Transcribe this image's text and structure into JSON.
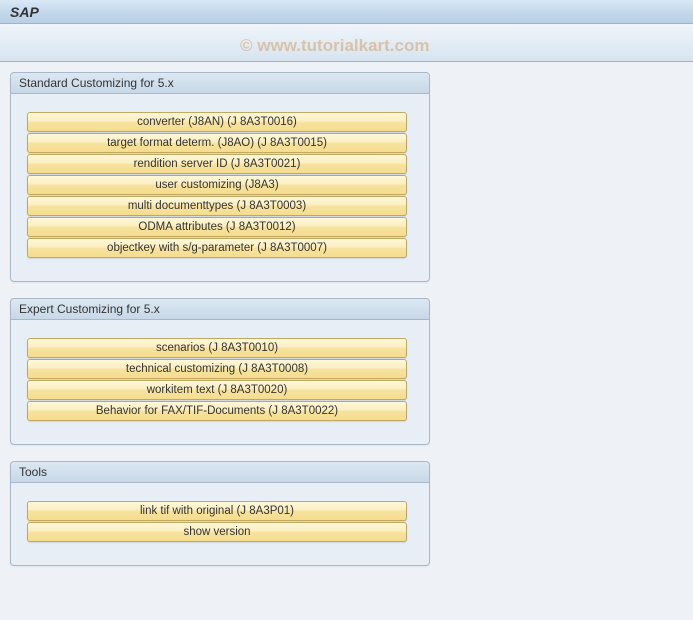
{
  "title": "SAP",
  "watermark": "© www.tutorialkart.com",
  "groups": [
    {
      "header": "Standard Customizing for 5.x",
      "buttons": [
        "converter (J8AN) (J 8A3T0016)",
        "target format determ. (J8AO) (J 8A3T0015)",
        "rendition server ID (J 8A3T0021)",
        "user customizing (J8A3)",
        "multi documenttypes (J 8A3T0003)",
        "ODMA attributes (J 8A3T0012)",
        "objectkey with s/g-parameter (J 8A3T0007)"
      ]
    },
    {
      "header": "Expert Customizing for 5.x",
      "buttons": [
        "scenarios (J 8A3T0010)",
        "technical customizing (J 8A3T0008)",
        "workitem text (J 8A3T0020)",
        "Behavior for FAX/TIF-Documents (J 8A3T0022)"
      ]
    },
    {
      "header": "Tools",
      "buttons": [
        "link tif with original (J 8A3P01)",
        "show version"
      ]
    }
  ]
}
